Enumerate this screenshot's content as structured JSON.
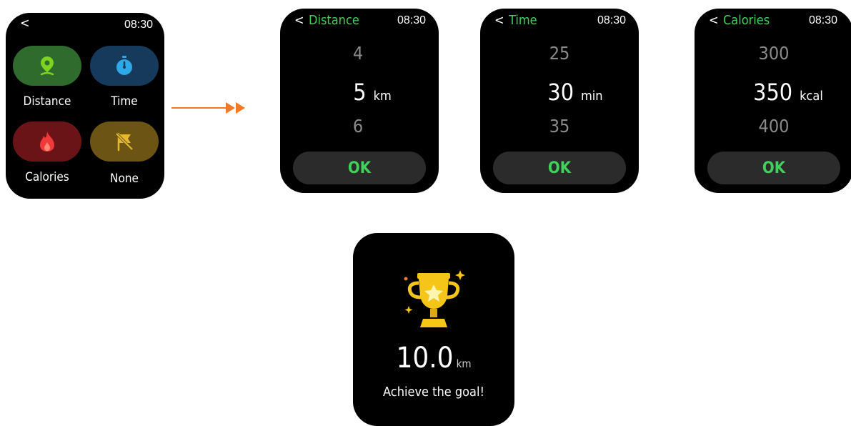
{
  "menu": {
    "back": "<",
    "time": "08:30",
    "options": [
      {
        "label": "Distance",
        "icon": "location-pin-icon",
        "color": "#2e6b2c",
        "icon_color": "#7ed321"
      },
      {
        "label": "Time",
        "icon": "stopwatch-icon",
        "color": "#163a5c",
        "icon_color": "#2ea8e6"
      },
      {
        "label": "Calories",
        "icon": "flame-icon",
        "color": "#6b1418",
        "icon_color": "#f03a3a"
      },
      {
        "label": "None",
        "icon": "flag-off-icon",
        "color": "#6b5414",
        "icon_color": "#e6b82e"
      }
    ]
  },
  "pickers": [
    {
      "title": "Distance",
      "back": "<",
      "time": "08:30",
      "prev": "4",
      "selected": "5",
      "unit": "km",
      "next": "6",
      "ok": "OK"
    },
    {
      "title": "Time",
      "back": "<",
      "time": "08:30",
      "prev": "25",
      "selected": "30",
      "unit": "min",
      "next": "35",
      "ok": "OK"
    },
    {
      "title": "Calories",
      "back": "<",
      "time": "08:30",
      "prev": "300",
      "selected": "350",
      "unit": "kcal",
      "next": "400",
      "ok": "OK"
    }
  ],
  "achievement": {
    "icon": "trophy-icon",
    "value": "10.0",
    "unit": "km",
    "message": "Achieve the goal!"
  },
  "colors": {
    "accent_green": "#3fd15a",
    "arrow_orange": "#f07a2a",
    "trophy_gold": "#f5c518"
  }
}
